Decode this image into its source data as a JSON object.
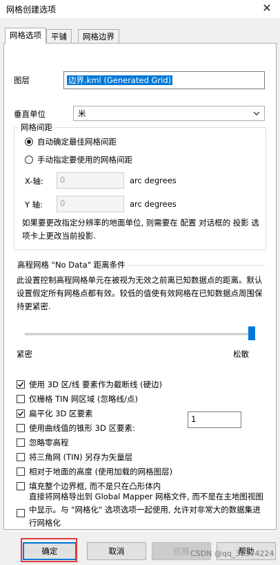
{
  "window": {
    "title": "网格创建选项",
    "close_glyph": "✕"
  },
  "tabs": [
    {
      "label": "网格选项",
      "active": true
    },
    {
      "label": "平铺",
      "active": false
    },
    {
      "label": "网格边界",
      "active": false
    }
  ],
  "layer": {
    "label": "图层",
    "value": "边界.kml (Generated Grid)"
  },
  "vertical_unit": {
    "label": "垂直单位",
    "selected": "米"
  },
  "spacing_group": {
    "legend": "网格间距",
    "auto_label": "自动确定最佳网格间距",
    "manual_label": "手动指定要使用的网格间距",
    "auto_selected": true,
    "x_label": "X-轴:",
    "x_value": "0",
    "y_label": "Y 轴:",
    "y_value": "0",
    "unit": "arc degrees",
    "hint": "如果要更改指定分辨率的地面单位, 则需要在 配置 对话框的 投影 选项卡上更改当前投影."
  },
  "nodata_group": {
    "legend": "高程网格 \"No Data\" 距离条件",
    "description": "此设置控制高程网格单元在被视为无效之前离已知数据点的距离。默认设置假定所有网格点都有效。较低的值使有效网格在已知数据点周围保持更紧密.",
    "slider_value_percent": 100,
    "min_label": "紧密",
    "max_label": "松散"
  },
  "options": [
    {
      "label": "使用 3D 区/线 要素作为截断线 (硬边)",
      "checked": true
    },
    {
      "label": "仅栅格 TIN 网区域 (忽略线/点)",
      "checked": false
    },
    {
      "label": "扁平化 3D 区要素",
      "checked": true
    },
    {
      "label": "使用曲线值的锥形 3D 区要素:",
      "checked": false
    },
    {
      "label": "忽略零高程",
      "checked": false
    },
    {
      "label": "将三角网 (TIN) 另存为矢量层",
      "checked": false
    },
    {
      "label": "相对于地面的高度 (使用加载的网格图层)",
      "checked": false
    },
    {
      "label": "填充整个边界框, 而不是只在凸形体内",
      "checked": false
    }
  ],
  "taper_value": "1",
  "export_option": {
    "label": "直接将网格导出到 Global Mapper 网格文件, 而不是在主地图视图中显示。与 \"网格化\" 选项选项一起使用, 允许对非常大的数据集进行网格化",
    "checked": false
  },
  "buttons": {
    "ok": "确定",
    "cancel": "取消",
    "apply": "应用",
    "help": "帮助"
  },
  "watermark": "CSDN @qq_38374224",
  "colors": {
    "accent": "#0078d7",
    "highlight_box": "#e53935"
  }
}
